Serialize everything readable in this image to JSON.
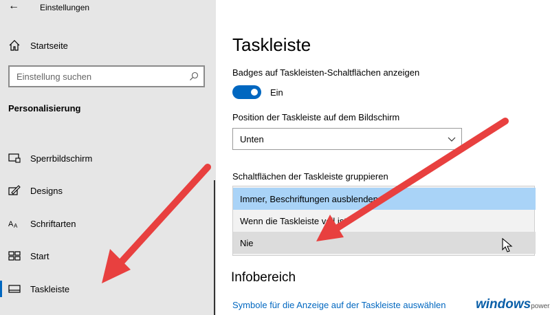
{
  "window": {
    "title": "Einstellungen"
  },
  "sidebar": {
    "home_label": "Startseite",
    "search_placeholder": "Einstellung suchen",
    "section_title": "Personalisierung",
    "items": [
      {
        "label": "Sperrbildschirm",
        "icon": "lockscreen-icon"
      },
      {
        "label": "Designs",
        "icon": "designs-icon"
      },
      {
        "label": "Schriftarten",
        "icon": "fonts-icon"
      },
      {
        "label": "Start",
        "icon": "start-icon"
      },
      {
        "label": "Taskleiste",
        "icon": "taskbar-icon",
        "active": true
      }
    ]
  },
  "main": {
    "title": "Taskleiste",
    "badges": {
      "label": "Badges auf Taskleisten-Schaltflächen anzeigen",
      "state": "Ein"
    },
    "position": {
      "label": "Position der Taskleiste auf dem Bildschirm",
      "value": "Unten"
    },
    "grouping": {
      "label": "Schaltflächen der Taskleiste gruppieren",
      "options": [
        "Immer, Beschriftungen ausblenden",
        "Wenn die Taskleiste voll ist",
        "Nie"
      ]
    },
    "notification_area": {
      "title": "Infobereich",
      "link": "Symbole für die Anzeige auf der Taskleiste auswählen"
    }
  },
  "watermark": {
    "main": "windows",
    "sub": "power.de"
  },
  "colors": {
    "accent": "#0067c0",
    "arrow": "#e8403f",
    "selected": "#a9d3f7"
  }
}
